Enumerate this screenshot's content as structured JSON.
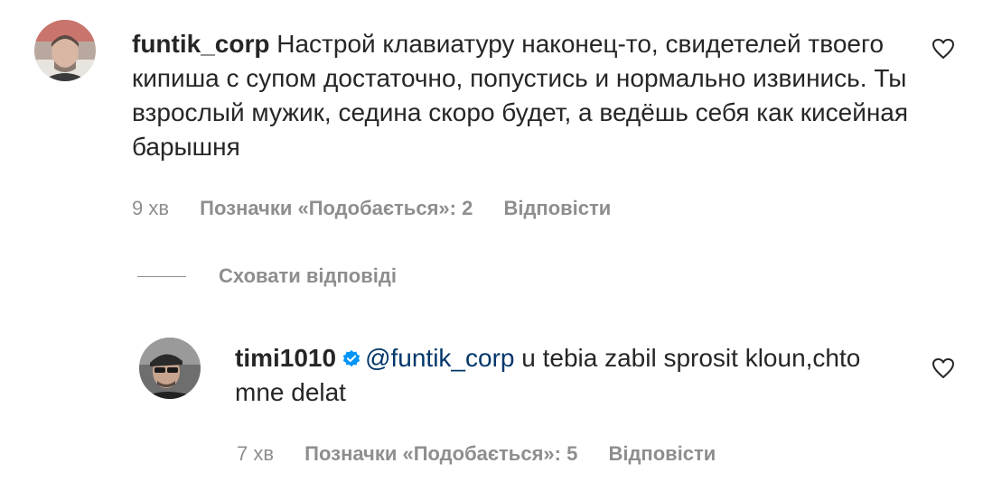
{
  "comments": [
    {
      "username": "funtik_corp",
      "text": "Настрой клавиатуру наконец-то, свидетелей твоего кипиша с супом достаточно, попустись и нормально извинись. Ты взрослый мужик, седина скоро будет, а ведёшь себя как кисейная барышня",
      "time": "9 хв",
      "likes_label": "Позначки «Подобається»: 2",
      "reply_label": "Відповісти",
      "avatar_icon": "user-avatar-photo",
      "like_icon": "heart-outline-icon"
    }
  ],
  "hide_replies_label": "Сховати відповіді",
  "replies": [
    {
      "username": "timi1010",
      "verified_icon": "verified-badge-icon",
      "mention": "@funtik_corp",
      "text": " u tebia zabil sprosit kloun,chto mne delat",
      "time": "7 хв",
      "likes_label": "Позначки «Подобається»: 5",
      "reply_label": "Відповісти",
      "avatar_icon": "user-avatar-photo",
      "like_icon": "heart-outline-icon"
    }
  ],
  "colors": {
    "text": "#262626",
    "secondary": "#8e8e8e",
    "mention": "#00376b",
    "verified": "#0095f6"
  }
}
